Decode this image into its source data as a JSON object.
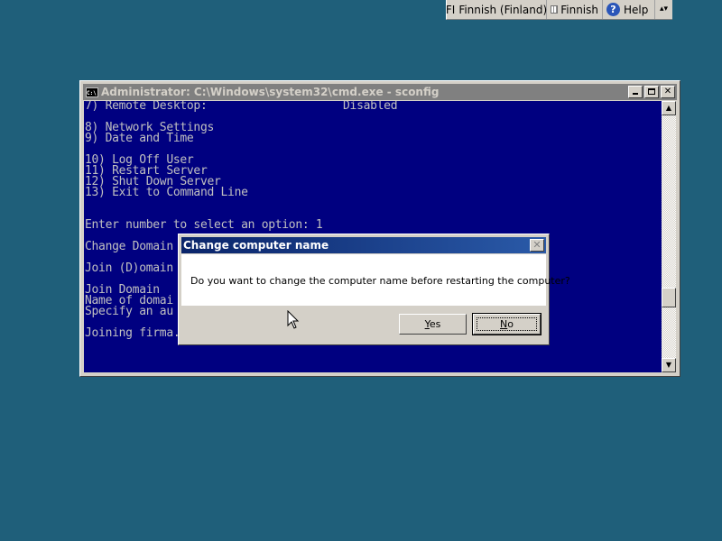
{
  "language_bar": {
    "lang_code": "FI",
    "lang_name": "Finnish (Finland)",
    "keyboard": "Finnish",
    "help": "Help",
    "help_glyph": "?",
    "options_glyph": "▴▾"
  },
  "console": {
    "title": "Administrator: C:\\Windows\\system32\\cmd.exe - sconfig",
    "icon_text": "C:\\",
    "lines": [
      "7) Remote Desktop:                    Disabled",
      "",
      "8) Network Settings",
      "9) Date and Time",
      "",
      "10) Log Off User",
      "11) Restart Server",
      "12) Shut Down Server",
      "13) Exit to Command Line",
      "",
      "",
      "Enter number to select an option: 1",
      "",
      "Change Domain",
      "",
      "Join (D)omain",
      "",
      "Join Domain",
      "Name of domai",
      "Specify an au",
      "",
      "Joining firma..."
    ],
    "scroll_up_glyph": "▲",
    "scroll_down_glyph": "▼"
  },
  "dialog": {
    "title": "Change computer name",
    "close_glyph": "✕",
    "message": "Do you want to change the computer name before restarting the computer?",
    "yes_mnemonic": "Y",
    "yes_rest": "es",
    "no_mnemonic": "N",
    "no_rest": "o"
  },
  "colors": {
    "desktop": "#1f5f7a",
    "console_bg": "#000080",
    "console_text": "#c0c0c0",
    "dialog_title": "#0a246a"
  },
  "icons": {
    "cursor": "arrow-cursor-icon",
    "help": "help-icon",
    "keyboard": "keyboard-icon",
    "console": "cmd-icon"
  }
}
